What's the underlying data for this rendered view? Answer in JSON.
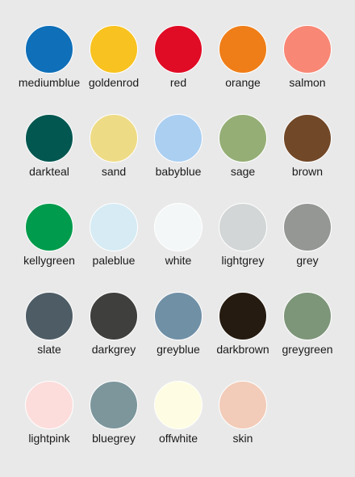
{
  "swatches": [
    {
      "name": "mediumblue",
      "color": "#0f6fb8"
    },
    {
      "name": "goldenrod",
      "color": "#f8c220"
    },
    {
      "name": "red",
      "color": "#e00b25"
    },
    {
      "name": "orange",
      "color": "#ef7e18"
    },
    {
      "name": "salmon",
      "color": "#f88775"
    },
    {
      "name": "darkteal",
      "color": "#025750"
    },
    {
      "name": "sand",
      "color": "#eedb86"
    },
    {
      "name": "babyblue",
      "color": "#abcff1"
    },
    {
      "name": "sage",
      "color": "#95ae76"
    },
    {
      "name": "brown",
      "color": "#714828"
    },
    {
      "name": "kellygreen",
      "color": "#009b4c"
    },
    {
      "name": "paleblue",
      "color": "#d6ebf4"
    },
    {
      "name": "white",
      "color": "#f4f7f8"
    },
    {
      "name": "lightgrey",
      "color": "#d2d6d6"
    },
    {
      "name": "grey",
      "color": "#949794"
    },
    {
      "name": "slate",
      "color": "#4e5c65"
    },
    {
      "name": "darkgrey",
      "color": "#3f3f3d"
    },
    {
      "name": "greyblue",
      "color": "#7090a6"
    },
    {
      "name": "darkbrown",
      "color": "#261b10"
    },
    {
      "name": "greygreen",
      "color": "#7d9579"
    },
    {
      "name": "lightpink",
      "color": "#fcdddc"
    },
    {
      "name": "bluegrey",
      "color": "#7c969c"
    },
    {
      "name": "offwhite",
      "color": "#fefde3"
    },
    {
      "name": "skin",
      "color": "#f2ccb9"
    }
  ]
}
